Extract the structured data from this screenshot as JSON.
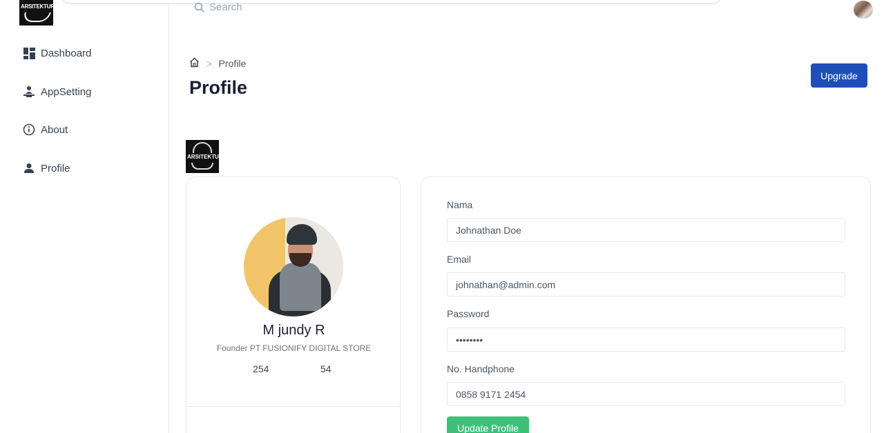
{
  "brand": {
    "logo_text": "ARSITEKTUR"
  },
  "sidebar": {
    "items": [
      {
        "label": "Dashboard",
        "icon": "dashboard-grid-icon"
      },
      {
        "label": "AppSetting",
        "icon": "person-desk-icon"
      },
      {
        "label": "About",
        "icon": "info-circle-icon"
      },
      {
        "label": "Profile",
        "icon": "user-icon"
      }
    ]
  },
  "topbar": {
    "search_placeholder": "Search"
  },
  "header": {
    "breadcrumb_current": "Profile",
    "title": "Profile",
    "upgrade_label": "Upgrade"
  },
  "profile": {
    "name": "M jundy R",
    "role": "Founder PT FUSIONIFY DIGITAL STORE",
    "stat_1": "254",
    "stat_2": "54"
  },
  "form": {
    "name_label": "Nama",
    "name_value": "Johnathan Doe",
    "email_label": "Email",
    "email_value": "johnathan@admin.com",
    "password_label": "Password",
    "password_value": "••••••••",
    "phone_label": "No. Handphone",
    "phone_value": "0858 9171 2454",
    "submit_label": "Update Profile"
  },
  "colors": {
    "upgrade_button": "#1e4fb8",
    "update_button": "#3ec07a",
    "title_text": "#1a1f36"
  }
}
